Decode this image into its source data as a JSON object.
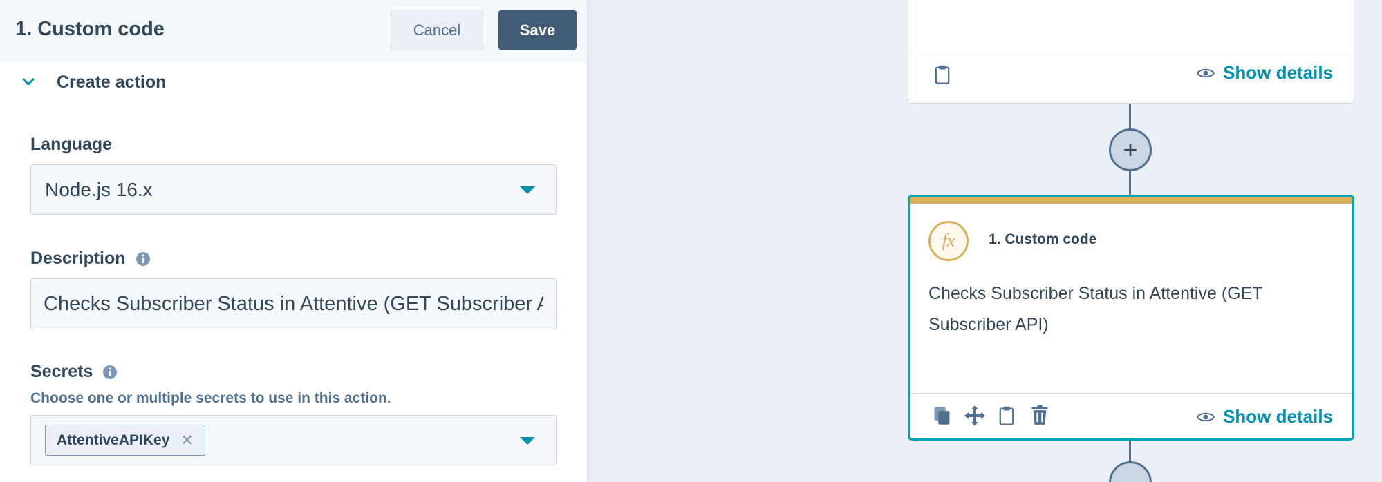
{
  "editor": {
    "title": "1. Custom code",
    "cancel_label": "Cancel",
    "save_label": "Save",
    "section_label": "Create action",
    "language": {
      "label": "Language",
      "value": "Node.js 16.x"
    },
    "description": {
      "label": "Description",
      "value": "Checks Subscriber Status in Attentive (GET Subscriber API)"
    },
    "secrets": {
      "label": "Secrets",
      "help": "Choose one or multiple secrets to use in this action.",
      "selected": [
        "AttentiveAPIKey"
      ]
    }
  },
  "canvas": {
    "top_card": {
      "show_details_label": "Show details"
    },
    "action_card": {
      "icon_text": "fx",
      "title": "1. Custom code",
      "description": "Checks Subscriber Status in Attentive (GET Subscriber API)",
      "show_details_label": "Show details",
      "accent_color": "#dbae58",
      "selected_border_color": "#00a4bd"
    },
    "add_step_symbol": "+"
  },
  "colors": {
    "link": "#0091ae",
    "primary_button": "#425b76",
    "text": "#33475b",
    "canvas_bg": "#eaf0f6"
  }
}
